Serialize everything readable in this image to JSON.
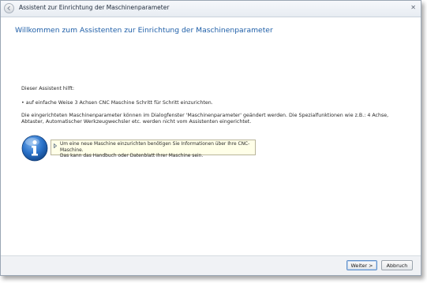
{
  "window": {
    "title": "Assistent zur Einrichtung der Maschinenparameter"
  },
  "page": {
    "heading": "Willkommen zum Assistenten zur Einrichtung der Maschinenparameter",
    "intro": "Dieser Assistent hilft:",
    "bullet": "•  auf einfache Weise 3 Achsen CNC Maschine Schritt für Schritt einzurichten.",
    "note": "Die eingerichteten Maschinenparameter können im Dialogfenster 'Maschinenparameter' geändert werden. Die Spezialfunktionen wie z.B.: 4 Achse, Abtaster, Automatischer Werkzeugwechsler etc. werden nicht vom Assistenten eingerichtet."
  },
  "info": {
    "line1": "Um eine neue Maschine einzurichten benötigen Sie Informationen über Ihre CNC- Maschine.",
    "line2": "Das kann das Handbuch oder Datenblatt Ihrer Maschine sein."
  },
  "buttons": {
    "next": "Weiter >",
    "cancel": "Abbruch"
  },
  "icons": {
    "back": "back-arrow-icon",
    "info": "info-icon",
    "tooltip_arrow": "triangle-right-icon",
    "close": "close-icon"
  },
  "colors": {
    "heading": "#1f5fa8",
    "info_blue": "#2a72c9",
    "tooltip_bg": "#ffffe8"
  }
}
